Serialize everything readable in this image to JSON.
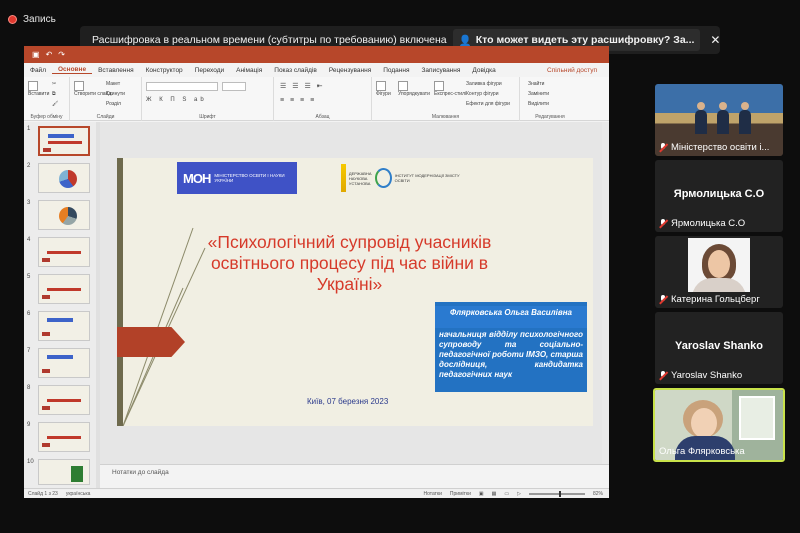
{
  "recording": {
    "label": "Запись"
  },
  "caption_banner": {
    "message": "Расшифровка в реальном времени (субтитры по требованию) включена",
    "who_can_see": "Кто может видеть эту расшифровку? За...",
    "close_icon": "close-icon"
  },
  "ppt": {
    "menu": [
      "Файл",
      "Основне",
      "Вставлення",
      "Конструктор",
      "Переходи",
      "Анімація",
      "Показ слайдів",
      "Рецензування",
      "Подання",
      "Записування",
      "Довідка"
    ],
    "active_tab": "Основне",
    "share": "Спільний доступ",
    "ribbon": {
      "paste": "Вставити",
      "create_slide": "Створити слайд",
      "layout": "Макет",
      "reset": "Скинути",
      "section": "Розділ",
      "shapes": "Фігури",
      "arrange": "Упорядкувати",
      "quick_styles": "Експрес-стилі",
      "shape_fill": "Заливка фігури",
      "shape_outline": "Контур фігури",
      "shape_effects": "Ефекти для фігури",
      "find": "Знайти",
      "replace": "Замінити",
      "select": "Виділити",
      "groups": [
        "Буфер обміну",
        "Слайди",
        "Шрифт",
        "Абзац",
        "Малювання",
        "Редагування"
      ]
    },
    "thumbnails": [
      "1",
      "2",
      "3",
      "4",
      "5",
      "6",
      "7",
      "8",
      "9",
      "10"
    ],
    "slide": {
      "logo_ministry": "МІНІСТЕРСТВО ОСВІТИ І НАУКИ УКРАЇНИ",
      "logo_service": "ДЕРЖАВНА НАУКОВА УСТАНОВА",
      "logo_institute": "ІНСТИТУТ МОДЕРНІЗАЦІЇ ЗМІСТУ ОСВІТИ",
      "title": "«Психологічний супровід учасників освітнього процесу під час війни в Україні»",
      "author_name": "Флярковська Ольга Василівна",
      "author_info": "начальниця відділу психологічного супроводу та соціально-педагогічної роботи ІМЗО, старша дослідниця, кандидатка педагогічних наук",
      "date": "Київ, 07 березня 2023"
    },
    "notes_placeholder": "Нотатки до слайда",
    "status": {
      "slide": "Слайд 1 з 23",
      "language": "українська",
      "notes": "Нотатки",
      "comments": "Примітки",
      "zoom": "82%"
    }
  },
  "participants": [
    {
      "name": "Міністерство освіти і...",
      "type": "video"
    },
    {
      "name": "Ярмолицька С.О",
      "big_name": "Ярмолицька С.О",
      "type": "name"
    },
    {
      "name": "Катерина Гольцберг",
      "type": "avatar"
    },
    {
      "name": "Yaroslav Shanko",
      "big_name": "Yaroslav Shanko",
      "type": "name"
    },
    {
      "name": "Ольга Флярковська",
      "type": "video",
      "speaking": true
    }
  ],
  "colors": {
    "ppt_accent": "#b7472a",
    "slide_title": "#d63a2a",
    "info_box": "#2372c2",
    "speaker_highlight": "#c8e24a"
  }
}
